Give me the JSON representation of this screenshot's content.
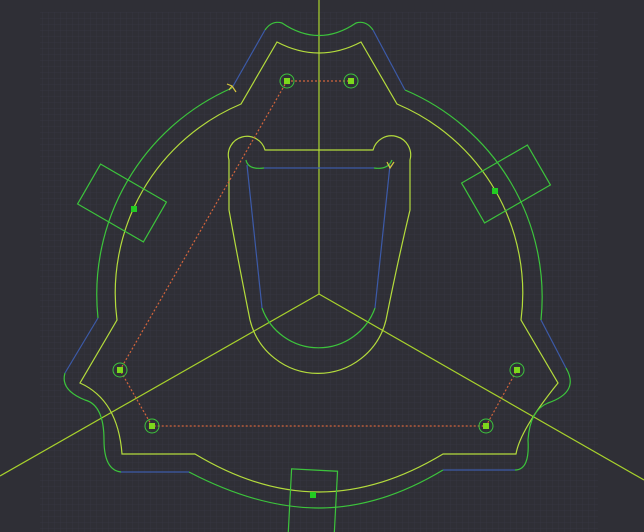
{
  "colors": {
    "background": "#2f2f36",
    "grid": "#383840",
    "profile": "#b4dc3c",
    "offset": "#3cc43c",
    "blue_segment": "#3c5aa8",
    "construction": "#a8d22c",
    "constraint_dotted": "#d2643c",
    "point": "#7cd81c"
  }
}
